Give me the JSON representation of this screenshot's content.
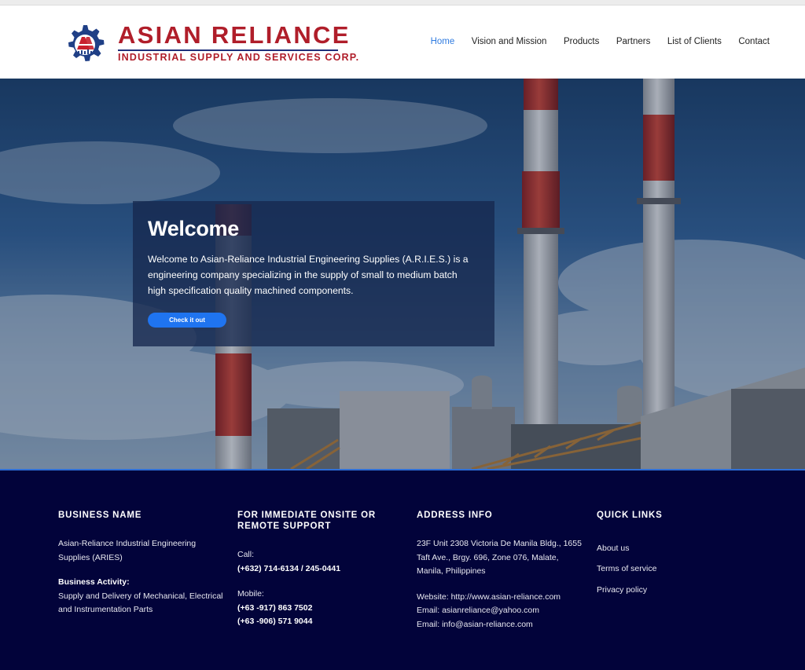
{
  "brand": {
    "title": "ASIAN RELIANCE",
    "subtitle": "INDUSTRIAL SUPPLY AND SERVICES CORP.",
    "colors": {
      "red": "#b01e2a",
      "navy": "#1f2f7a"
    }
  },
  "nav": {
    "items": [
      {
        "label": "Home",
        "active": true
      },
      {
        "label": "Vision and Mission"
      },
      {
        "label": "Products"
      },
      {
        "label": "Partners"
      },
      {
        "label": "List of Clients"
      },
      {
        "label": "Contact"
      }
    ],
    "active_color": "#2f7be0"
  },
  "hero": {
    "title": "Welcome",
    "text": "Welcome to Asian-Reliance Industrial Engineering Supplies (A.R.I.E.S.) is a engineering company specializing in the supply of small to medium batch high specification quality machined components.",
    "button_label": "Check it out",
    "button_color": "#1f74f0"
  },
  "footer": {
    "background": "#02033a",
    "business": {
      "heading": "BUSINESS NAME",
      "name": "Asian-Reliance Industrial Engineering Supplies (ARIES)",
      "activity_label": "Business Activity:",
      "activity": "Supply and Delivery of Mechanical, Electrical and Instrumentation Parts"
    },
    "support": {
      "heading": "FOR IMMEDIATE ONSITE OR REMOTE SUPPORT",
      "call_label": "Call:",
      "call_numbers": "(+632) 714-6134 / 245-0441",
      "mobile_label": "Mobile:",
      "mobile_1": "(+63 -917) 863 7502",
      "mobile_2": "(+63 -906) 571 9044"
    },
    "address": {
      "heading": "ADDRESS INFO",
      "address": "23F Unit 2308 Victoria De Manila Bldg., 1655 Taft Ave., Brgy. 696, Zone 076, Malate, Manila, Philippines",
      "website": "Website: http://www.asian-reliance.com",
      "email_1": "Email: asianreliance@yahoo.com",
      "email_2": "Email: info@asian-reliance.com"
    },
    "quick_links": {
      "heading": "QUICK LINKS",
      "links": [
        "About us",
        "Terms of service",
        "Privacy policy"
      ]
    }
  }
}
